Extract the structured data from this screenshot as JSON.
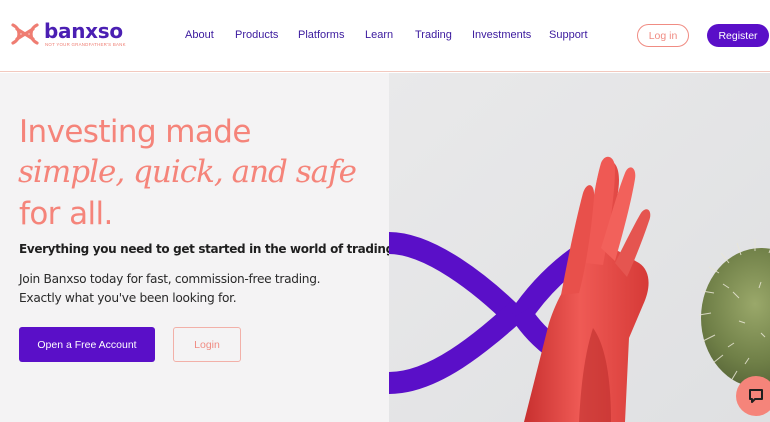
{
  "brand": {
    "name": "banxso",
    "tagline": "NOT YOUR GRANDFATHER'S BANK",
    "logo_icon": "x-knot-logo-icon"
  },
  "nav": {
    "items": [
      {
        "label": "About"
      },
      {
        "label": "Products"
      },
      {
        "label": "Platforms"
      },
      {
        "label": "Learn"
      },
      {
        "label": "Trading"
      },
      {
        "label": "Investments"
      },
      {
        "label": "Support"
      }
    ],
    "login_label": "Log in",
    "register_label": "Register"
  },
  "hero": {
    "headline_line1": "Investing made",
    "headline_line2": "simple, quick, and safe",
    "headline_line3": "for all.",
    "lead": "Everything you need to get started in the world of trading.",
    "sub": "Join Banxso today for fast, commission-free trading. Exactly what you've been looking for.",
    "primary_cta": "Open a Free Account",
    "secondary_cta": "Login",
    "image_subject": "red-gloved-hand-with-cactus"
  },
  "chat": {
    "icon": "chat-bubble-icon"
  },
  "colors": {
    "brand_purple": "#5a0fc8",
    "nav_text": "#3b1a9e",
    "coral": "#f5847a",
    "hero_bg": "#f4f3f4"
  }
}
